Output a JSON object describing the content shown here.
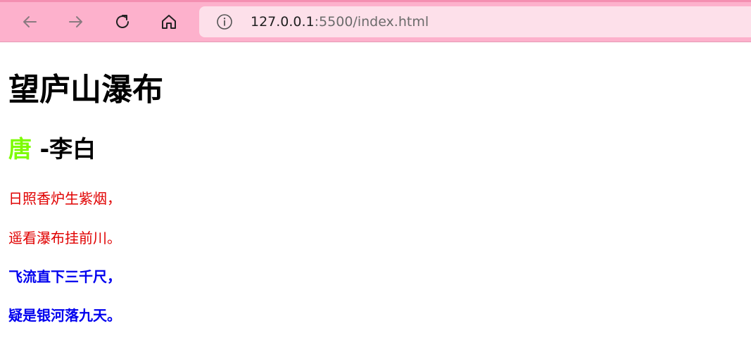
{
  "browser": {
    "url_host": "127.0.0.1",
    "url_rest": ":5500/index.html",
    "toolbar_color": "#fdb1cc",
    "icons": [
      "back-arrow-icon",
      "forward-arrow-icon",
      "reload-icon",
      "home-icon",
      "info-icon"
    ]
  },
  "page": {
    "title": "望庐山瀑布",
    "dynasty": "唐",
    "author": " -李白",
    "lines": [
      "日照香炉生紫烟，",
      "遥看瀑布挂前川。",
      "飞流直下三千尺，",
      "疑是银河落九天。"
    ],
    "colors": {
      "dynasty": "#7cfc00",
      "red_lines": "#e00000",
      "blue_lines": "#0000ee"
    }
  }
}
